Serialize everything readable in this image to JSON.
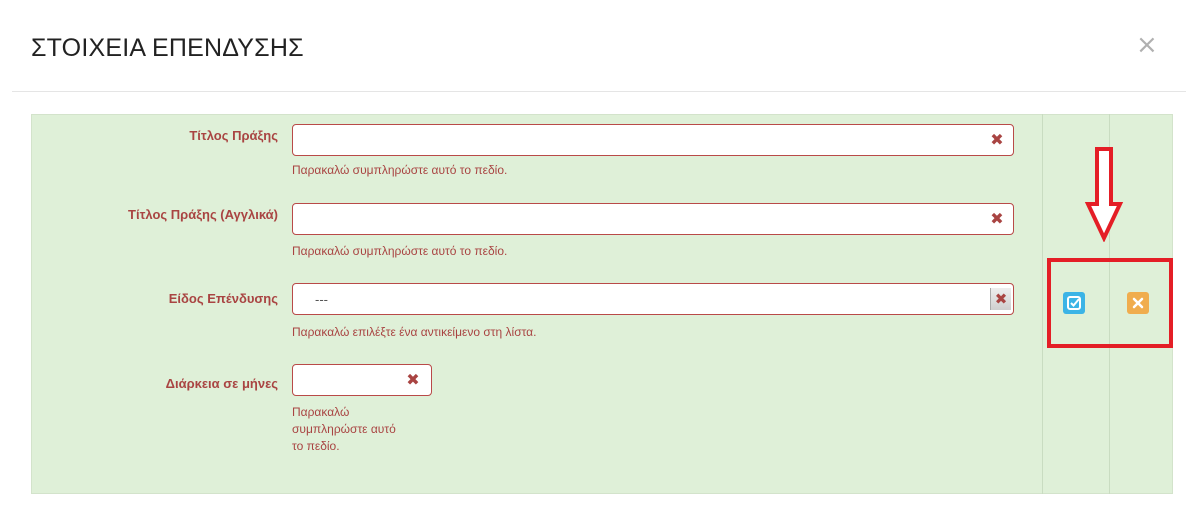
{
  "modal": {
    "title": "ΣΤΟΙΧΕΙΑ ΕΠΕΝΔΥΣΗΣ",
    "close_icon": "×"
  },
  "form": {
    "fields": [
      {
        "label": "Τίτλος Πράξης",
        "value": "",
        "help": "Παρακαλώ συμπληρώστε αυτό το πεδίο."
      },
      {
        "label": "Τίτλος Πράξης (Αγγλικά)",
        "value": "",
        "help": "Παρακαλώ συμπληρώστε αυτό το πεδίο."
      },
      {
        "label": "Είδος Επένδυσης",
        "value": "---",
        "help": "Παρακαλώ επιλέξτε ένα αντικείμενο στη λίστα."
      },
      {
        "label": "Διάρκεια σε μήνες",
        "value": "",
        "help_lines": [
          "Παρακαλώ",
          "συμπληρώστε αυτό",
          "το πεδίο."
        ]
      }
    ],
    "clear_icon": "✖"
  },
  "actions": {
    "confirm_icon": "check-square-icon",
    "cancel_icon": "times-icon"
  },
  "colors": {
    "panel_bg": "#dff0d8",
    "error_red": "#a94442",
    "confirm_blue": "#3bb4e6",
    "cancel_orange": "#f0ad4e",
    "annotation_red": "#e41e26"
  }
}
